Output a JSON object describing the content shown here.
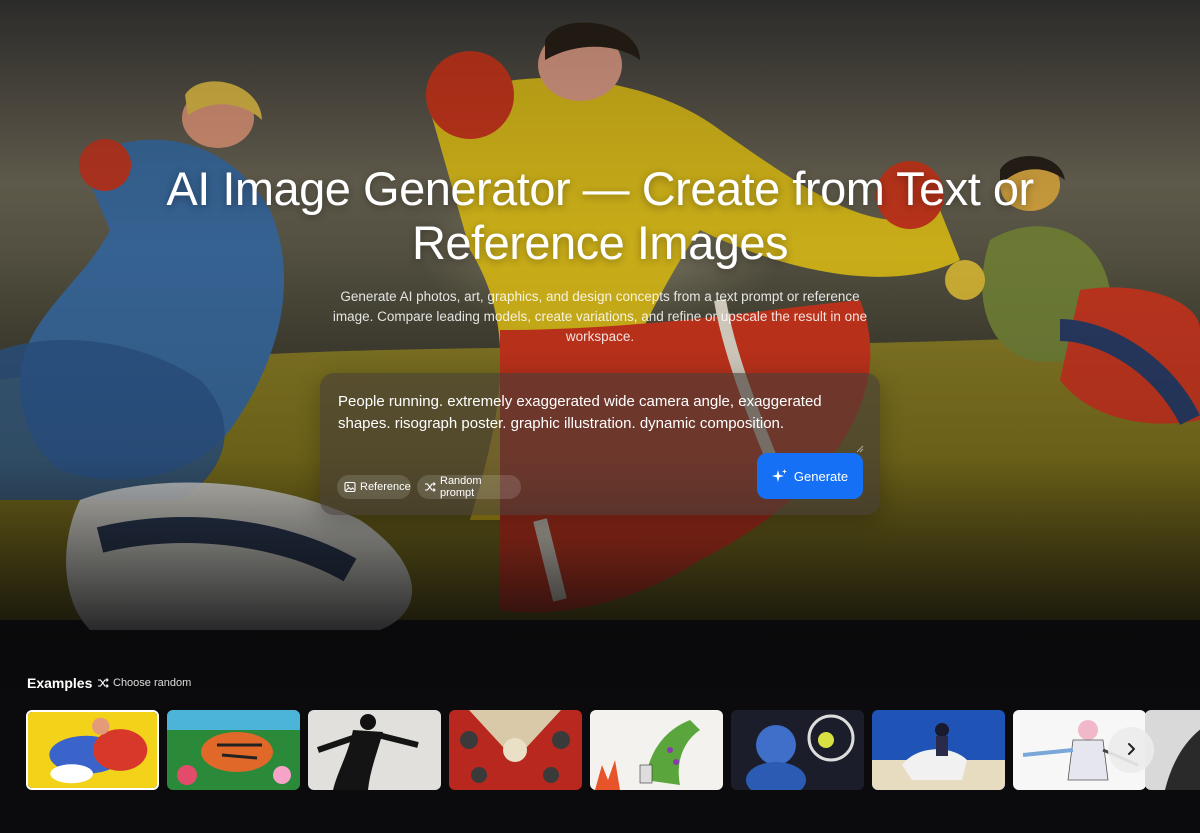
{
  "hero": {
    "title": "AI Image Generator — Create from Text or Reference Images",
    "subtitle": "Generate AI photos, art, graphics, and design concepts from a text prompt or reference image. Compare leading models, create variations, and refine or upscale the result in one workspace."
  },
  "prompt": {
    "value": "People running. extremely exaggerated wide camera angle, exaggerated shapes. risograph poster. graphic illustration. dynamic composition.",
    "reference_label": "Reference",
    "random_prompt_label": "Random prompt",
    "generate_label": "Generate"
  },
  "examples": {
    "label": "Examples",
    "choose_random_label": "Choose random",
    "thumbnails": [
      {
        "subject": "running figures illustration",
        "selected": true
      },
      {
        "subject": "tiger in jungle"
      },
      {
        "subject": "silhouette dancer"
      },
      {
        "subject": "dragon heads poster"
      },
      {
        "subject": "green crocodile drawing"
      },
      {
        "subject": "tennis player"
      },
      {
        "subject": "anime rider on horse"
      },
      {
        "subject": "anime warrior"
      },
      {
        "subject": "partial thumbnail"
      }
    ]
  },
  "colors": {
    "accent": "#1670f6",
    "background": "#0b0b0d"
  },
  "icons": {
    "reference": "image-icon",
    "random_prompt": "shuffle-icon",
    "generate": "sparkle-icon",
    "choose_random": "shuffle-icon",
    "next": "chevron-right-icon"
  }
}
